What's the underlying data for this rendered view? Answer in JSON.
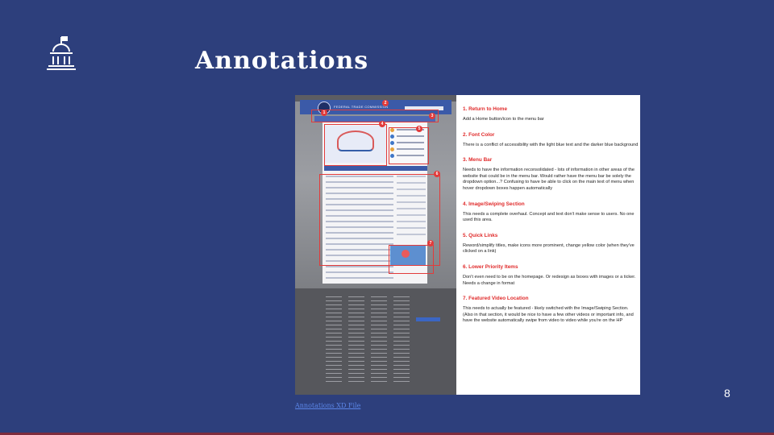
{
  "slide": {
    "title": "Annotations",
    "logo_icon": "capitol-building-icon",
    "page_number": "8",
    "link_text": "Annotations XD File",
    "colors": {
      "background": "#2d3f7c",
      "accent_red": "#e02b2b",
      "link": "#5b86e8"
    }
  },
  "annotations": [
    {
      "heading": "1. Return to Home",
      "body": "Add a Home button/icon to the menu bar"
    },
    {
      "heading": "2. Font Color",
      "body": "There is a conflict of accessibility with the light blue text and the darker blue background"
    },
    {
      "heading": "3. Menu Bar",
      "body": "Needs to have the information reconsolidated - lots of information in other areas of the website that could be in the menu bar. Would rather have the menu bar be solely the dropdown option...? Confusing to have be able to click on the main text of menu when hover dropdown boxes happen automatically"
    },
    {
      "heading": "4. Image/Swiping Section",
      "body": "This needs a complete overhaul. Concept and text don't make sense to users. No one used this area."
    },
    {
      "heading": "5. Quick Links",
      "body": "Reword/simplify titles, make icons more prominent, change yellow color (when they've clicked on a link)"
    },
    {
      "heading": "6. Lower Priority Items",
      "body": "Don't even need to be on the homepage. Or redesign as boxes with images or a ticker. Needs a change in format"
    },
    {
      "heading": "7. Featured Video Location",
      "body": "This needs to actually be featured - likely switched with the Image/Swiping Section. (Also in that section, it would be nice to have a few other videos or important info, and have the website automatically swipe from video to video while you're on the HP"
    }
  ],
  "screenshot_badges": [
    "1",
    "2",
    "3",
    "4",
    "5",
    "6",
    "7"
  ],
  "screenshot_brand": "FEDERAL TRADE COMMISSION"
}
